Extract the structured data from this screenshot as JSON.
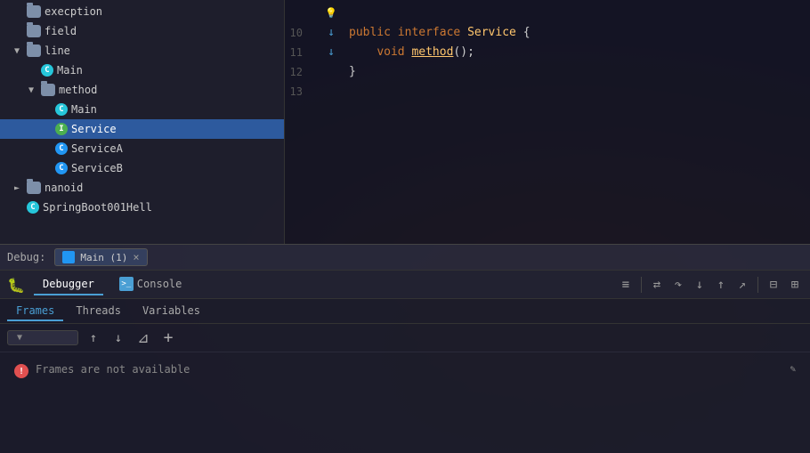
{
  "background": {
    "overlay": "dark fantasy"
  },
  "sidebar": {
    "items": [
      {
        "id": "exception",
        "label": "execption",
        "type": "folder",
        "indent": 0,
        "arrow": null
      },
      {
        "id": "field",
        "label": "field",
        "type": "folder",
        "indent": 0,
        "arrow": null
      },
      {
        "id": "line",
        "label": "line",
        "type": "folder",
        "indent": 0,
        "arrow": "▼"
      },
      {
        "id": "main1",
        "label": "Main",
        "type": "main",
        "indent": 1,
        "arrow": null
      },
      {
        "id": "method",
        "label": "method",
        "type": "folder",
        "indent": 1,
        "arrow": "▼"
      },
      {
        "id": "main2",
        "label": "Main",
        "type": "main",
        "indent": 2,
        "arrow": null
      },
      {
        "id": "service",
        "label": "Service",
        "type": "interface",
        "indent": 2,
        "arrow": null,
        "selected": true
      },
      {
        "id": "serviceA",
        "label": "ServiceA",
        "type": "class",
        "indent": 2,
        "arrow": null
      },
      {
        "id": "serviceB",
        "label": "ServiceB",
        "type": "class",
        "indent": 2,
        "arrow": null
      },
      {
        "id": "nanoid",
        "label": "nanoid",
        "type": "folder",
        "indent": 0,
        "arrow": "►"
      },
      {
        "id": "springboot",
        "label": "SpringBoot001Hell",
        "type": "main",
        "indent": 0,
        "arrow": null
      }
    ]
  },
  "editor": {
    "lines": [
      {
        "num": "",
        "gutter": "💡",
        "code": ""
      },
      {
        "num": "10",
        "gutter": "↓",
        "code": "public interface Service {"
      },
      {
        "num": "11",
        "gutter": "↓",
        "code": "    void method();"
      },
      {
        "num": "12",
        "gutter": "",
        "code": "}"
      },
      {
        "num": "13",
        "gutter": "",
        "code": ""
      }
    ]
  },
  "debug_bar": {
    "label": "Debug:",
    "session_label": "Main (1)",
    "close": "×"
  },
  "debug_panel": {
    "tabs": [
      {
        "id": "debugger",
        "label": "Debugger",
        "active": false
      },
      {
        "id": "console",
        "label": "Console",
        "active": false
      }
    ],
    "toolbar_icons": [
      "≡",
      "↕",
      "↓",
      "↑",
      "↗",
      "⊟",
      "⊞"
    ],
    "sub_tabs": [
      {
        "id": "frames",
        "label": "Frames",
        "active": true
      },
      {
        "id": "threads",
        "label": "Threads",
        "active": false
      },
      {
        "id": "variables",
        "label": "Variables",
        "active": false
      }
    ],
    "frames_toolbar": {
      "dropdown_label": "",
      "up_label": "↑",
      "down_label": "↓",
      "filter_label": "⊿",
      "plus_label": "+"
    },
    "frames_message": "Frames are not available"
  }
}
